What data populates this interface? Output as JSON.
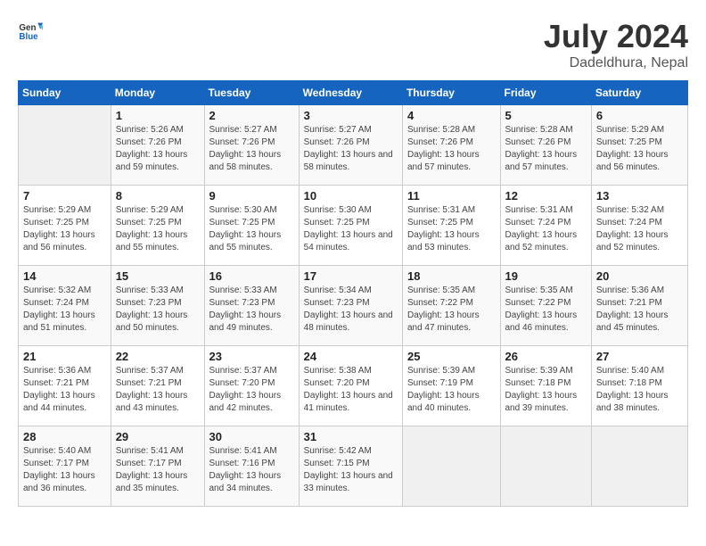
{
  "header": {
    "logo_general": "General",
    "logo_blue": "Blue",
    "month_year": "July 2024",
    "location": "Dadeldhura, Nepal"
  },
  "weekdays": [
    "Sunday",
    "Monday",
    "Tuesday",
    "Wednesday",
    "Thursday",
    "Friday",
    "Saturday"
  ],
  "weeks": [
    [
      {
        "day": "",
        "empty": true
      },
      {
        "day": "1",
        "sunrise": "5:26 AM",
        "sunset": "7:26 PM",
        "daylight": "13 hours and 59 minutes."
      },
      {
        "day": "2",
        "sunrise": "5:27 AM",
        "sunset": "7:26 PM",
        "daylight": "13 hours and 58 minutes."
      },
      {
        "day": "3",
        "sunrise": "5:27 AM",
        "sunset": "7:26 PM",
        "daylight": "13 hours and 58 minutes."
      },
      {
        "day": "4",
        "sunrise": "5:28 AM",
        "sunset": "7:26 PM",
        "daylight": "13 hours and 57 minutes."
      },
      {
        "day": "5",
        "sunrise": "5:28 AM",
        "sunset": "7:26 PM",
        "daylight": "13 hours and 57 minutes."
      },
      {
        "day": "6",
        "sunrise": "5:29 AM",
        "sunset": "7:25 PM",
        "daylight": "13 hours and 56 minutes."
      }
    ],
    [
      {
        "day": "7",
        "sunrise": "5:29 AM",
        "sunset": "7:25 PM",
        "daylight": "13 hours and 56 minutes."
      },
      {
        "day": "8",
        "sunrise": "5:29 AM",
        "sunset": "7:25 PM",
        "daylight": "13 hours and 55 minutes."
      },
      {
        "day": "9",
        "sunrise": "5:30 AM",
        "sunset": "7:25 PM",
        "daylight": "13 hours and 55 minutes."
      },
      {
        "day": "10",
        "sunrise": "5:30 AM",
        "sunset": "7:25 PM",
        "daylight": "13 hours and 54 minutes."
      },
      {
        "day": "11",
        "sunrise": "5:31 AM",
        "sunset": "7:25 PM",
        "daylight": "13 hours and 53 minutes."
      },
      {
        "day": "12",
        "sunrise": "5:31 AM",
        "sunset": "7:24 PM",
        "daylight": "13 hours and 52 minutes."
      },
      {
        "day": "13",
        "sunrise": "5:32 AM",
        "sunset": "7:24 PM",
        "daylight": "13 hours and 52 minutes."
      }
    ],
    [
      {
        "day": "14",
        "sunrise": "5:32 AM",
        "sunset": "7:24 PM",
        "daylight": "13 hours and 51 minutes."
      },
      {
        "day": "15",
        "sunrise": "5:33 AM",
        "sunset": "7:23 PM",
        "daylight": "13 hours and 50 minutes."
      },
      {
        "day": "16",
        "sunrise": "5:33 AM",
        "sunset": "7:23 PM",
        "daylight": "13 hours and 49 minutes."
      },
      {
        "day": "17",
        "sunrise": "5:34 AM",
        "sunset": "7:23 PM",
        "daylight": "13 hours and 48 minutes."
      },
      {
        "day": "18",
        "sunrise": "5:35 AM",
        "sunset": "7:22 PM",
        "daylight": "13 hours and 47 minutes."
      },
      {
        "day": "19",
        "sunrise": "5:35 AM",
        "sunset": "7:22 PM",
        "daylight": "13 hours and 46 minutes."
      },
      {
        "day": "20",
        "sunrise": "5:36 AM",
        "sunset": "7:21 PM",
        "daylight": "13 hours and 45 minutes."
      }
    ],
    [
      {
        "day": "21",
        "sunrise": "5:36 AM",
        "sunset": "7:21 PM",
        "daylight": "13 hours and 44 minutes."
      },
      {
        "day": "22",
        "sunrise": "5:37 AM",
        "sunset": "7:21 PM",
        "daylight": "13 hours and 43 minutes."
      },
      {
        "day": "23",
        "sunrise": "5:37 AM",
        "sunset": "7:20 PM",
        "daylight": "13 hours and 42 minutes."
      },
      {
        "day": "24",
        "sunrise": "5:38 AM",
        "sunset": "7:20 PM",
        "daylight": "13 hours and 41 minutes."
      },
      {
        "day": "25",
        "sunrise": "5:39 AM",
        "sunset": "7:19 PM",
        "daylight": "13 hours and 40 minutes."
      },
      {
        "day": "26",
        "sunrise": "5:39 AM",
        "sunset": "7:18 PM",
        "daylight": "13 hours and 39 minutes."
      },
      {
        "day": "27",
        "sunrise": "5:40 AM",
        "sunset": "7:18 PM",
        "daylight": "13 hours and 38 minutes."
      }
    ],
    [
      {
        "day": "28",
        "sunrise": "5:40 AM",
        "sunset": "7:17 PM",
        "daylight": "13 hours and 36 minutes."
      },
      {
        "day": "29",
        "sunrise": "5:41 AM",
        "sunset": "7:17 PM",
        "daylight": "13 hours and 35 minutes."
      },
      {
        "day": "30",
        "sunrise": "5:41 AM",
        "sunset": "7:16 PM",
        "daylight": "13 hours and 34 minutes."
      },
      {
        "day": "31",
        "sunrise": "5:42 AM",
        "sunset": "7:15 PM",
        "daylight": "13 hours and 33 minutes."
      },
      {
        "day": "",
        "empty": true
      },
      {
        "day": "",
        "empty": true
      },
      {
        "day": "",
        "empty": true
      }
    ]
  ]
}
